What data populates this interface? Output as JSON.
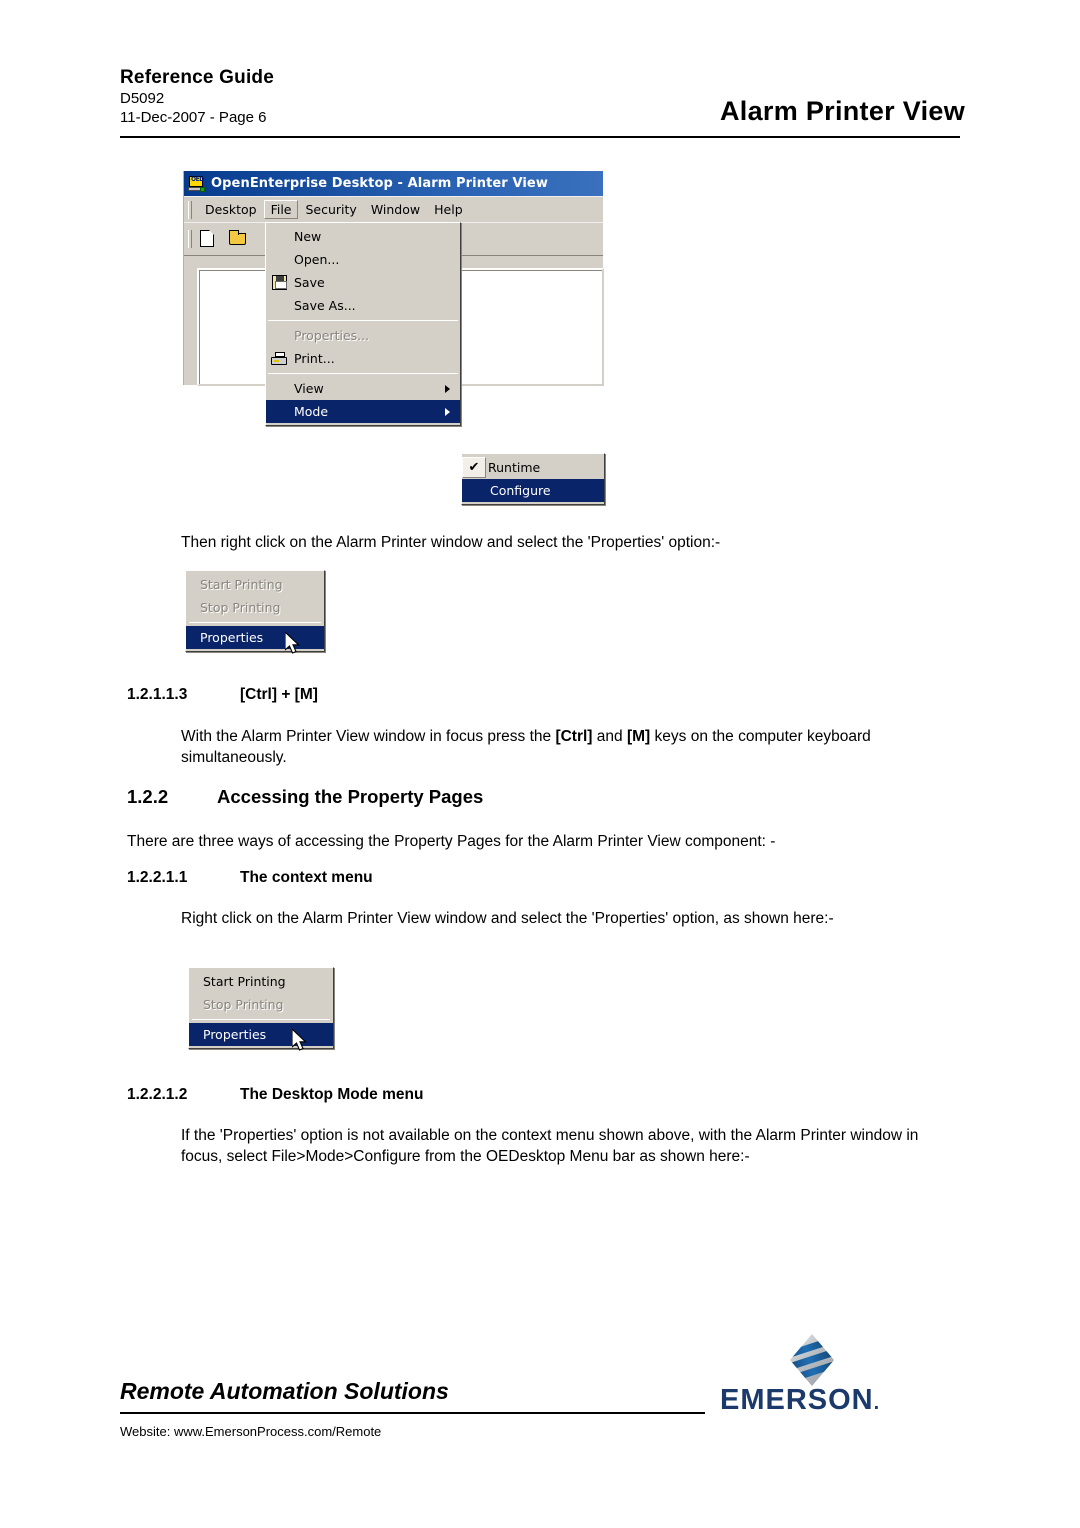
{
  "header": {
    "guide_title": "Reference Guide",
    "doc_number": "D5092",
    "doc_date_page": "11-Dec-2007 - Page 6",
    "page_title": "Alarm Printer View"
  },
  "oe_window": {
    "icon": "oed-computer-icon",
    "title": "OpenEnterprise Desktop - Alarm Printer View",
    "menubar": [
      "Desktop",
      "File",
      "Security",
      "Window",
      "Help"
    ],
    "active_menubar_item": "File",
    "toolbar_icons": [
      "new-document-icon",
      "open-folder-icon"
    ],
    "file_menu": [
      {
        "label": "New",
        "icon": "",
        "state": "normal"
      },
      {
        "label": "Open...",
        "icon": "",
        "state": "normal"
      },
      {
        "label": "Save",
        "icon": "save-disk-icon",
        "state": "normal"
      },
      {
        "label": "Save As...",
        "icon": "",
        "state": "normal"
      },
      {
        "label": "separator",
        "icon": "",
        "state": "separator"
      },
      {
        "label": "Properties...",
        "icon": "",
        "state": "disabled"
      },
      {
        "label": "Print...",
        "icon": "printer-icon",
        "state": "normal"
      },
      {
        "label": "separator",
        "icon": "",
        "state": "separator"
      },
      {
        "label": "View",
        "icon": "",
        "state": "submenu"
      },
      {
        "label": "Mode",
        "icon": "",
        "state": "submenu-selected"
      }
    ],
    "mode_submenu": [
      {
        "label": "Runtime",
        "checked": true,
        "state": "normal"
      },
      {
        "label": "Configure",
        "checked": false,
        "state": "selected"
      }
    ],
    "cursor": "mouse-pointer"
  },
  "paragraph_1": "Then right click on the Alarm Printer window and select the 'Properties' option:-",
  "context_menu_1": {
    "items": [
      {
        "label": "Start Printing",
        "state": "disabled"
      },
      {
        "label": "Stop Printing",
        "state": "disabled"
      },
      {
        "label": "separator",
        "state": "separator"
      },
      {
        "label": "Properties",
        "state": "selected"
      }
    ],
    "cursor": "mouse-pointer"
  },
  "section_ctrl_m": {
    "number": "1.2.1.1.3",
    "title": "[Ctrl] + [M]",
    "body_parts": [
      {
        "text": "With the Alarm Printer View window in focus press the ",
        "bold": false
      },
      {
        "text": "[Ctrl]",
        "bold": true
      },
      {
        "text": " and ",
        "bold": false
      },
      {
        "text": "[M]",
        "bold": true
      },
      {
        "text": " keys on the computer keyboard simultaneously.",
        "bold": false
      }
    ]
  },
  "section_1_2_2": {
    "number": "1.2.2",
    "title": "Accessing the Property Pages",
    "intro": "There are three ways of accessing the Property Pages for the Alarm Printer View component: -"
  },
  "section_context_menu": {
    "number": "1.2.2.1.1",
    "title": "The context menu",
    "body": "Right click on the Alarm Printer View window and select the 'Properties' option, as shown here:-"
  },
  "context_menu_2": {
    "items": [
      {
        "label": "Start Printing",
        "state": "normal"
      },
      {
        "label": "Stop Printing",
        "state": "disabled"
      },
      {
        "label": "separator",
        "state": "separator"
      },
      {
        "label": "Properties",
        "state": "selected"
      }
    ],
    "cursor": "mouse-pointer"
  },
  "section_desktop_mode": {
    "number": "1.2.2.1.2",
    "title": "The Desktop Mode menu",
    "body": "If the 'Properties' option is not available on the context menu shown above, with the Alarm Printer window in focus, select File>Mode>Configure from the OEDesktop Menu bar as shown here:-"
  },
  "footer": {
    "brand_line": "Remote Automation Solutions",
    "website": "Website:  www.EmersonProcess.com/Remote",
    "logo_text": "EMERSON",
    "logo_mark": "emerson-diamond-logo"
  },
  "colors": {
    "title_bar_blue": "#0a246a",
    "menu_highlight": "#0a246a",
    "window_face": "#d4d0c8",
    "emerson_blue": "#1b3a6b",
    "emerson_mark_blue": "#1f6fb5"
  }
}
